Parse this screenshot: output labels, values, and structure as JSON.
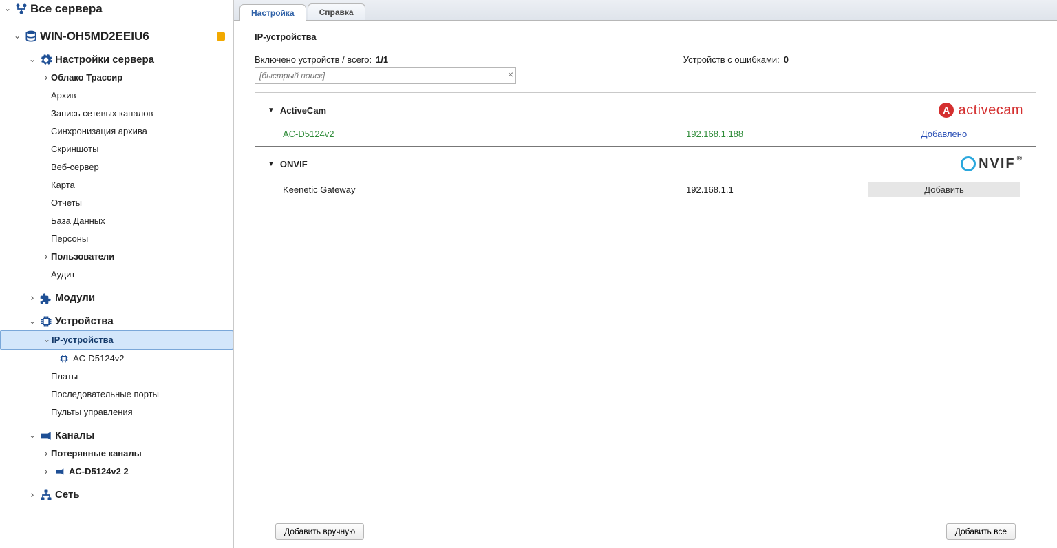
{
  "sidebar": {
    "root": {
      "label": "Все сервера"
    },
    "server": {
      "label": "WIN-OH5MD2EEIU6"
    },
    "settings": {
      "label": "Настройки сервера"
    },
    "cloud": {
      "label": "Облако Трассир"
    },
    "archive": {
      "label": "Архив"
    },
    "netrec": {
      "label": "Запись сетевых каналов"
    },
    "archsync": {
      "label": "Синхронизация архива"
    },
    "screenshots": {
      "label": "Скриншоты"
    },
    "webserver": {
      "label": "Веб-сервер"
    },
    "map": {
      "label": "Карта"
    },
    "reports": {
      "label": "Отчеты"
    },
    "database": {
      "label": "База Данных"
    },
    "persons": {
      "label": "Персоны"
    },
    "users": {
      "label": "Пользователи"
    },
    "audit": {
      "label": "Аудит"
    },
    "modules": {
      "label": "Модули"
    },
    "devices": {
      "label": "Устройства"
    },
    "ipdev": {
      "label": "IP-устройства"
    },
    "ipdev_child": {
      "label": "AC-D5124v2"
    },
    "boards": {
      "label": "Платы"
    },
    "serialports": {
      "label": "Последовательные порты"
    },
    "controlpanels": {
      "label": "Пульты управления"
    },
    "channels": {
      "label": "Каналы"
    },
    "lostch": {
      "label": "Потерянные каналы"
    },
    "camch": {
      "label": "AC-D5124v2 2"
    },
    "network": {
      "label": "Сеть"
    }
  },
  "tabs": {
    "settings": "Настройка",
    "help": "Справка"
  },
  "page": {
    "title": "IP-устройства",
    "enabled_label": "Включено устройств / всего:",
    "enabled_value": "1/1",
    "errors_label": "Устройств с ошибками:",
    "errors_value": "0",
    "search_placeholder": "[быстрый поиск]"
  },
  "groups": [
    {
      "name": "ActiveCam",
      "logo": "activecam",
      "devices": [
        {
          "name": "AC-D5124v2",
          "ip": "192.168.1.188",
          "action_type": "added",
          "action_label": "Добавлено"
        }
      ]
    },
    {
      "name": "ONVIF",
      "logo": "onvif",
      "devices": [
        {
          "name": "Keenetic Gateway",
          "ip": "192.168.1.1",
          "action_type": "button",
          "action_label": "Добавить"
        }
      ]
    }
  ],
  "logos": {
    "activecam_text": "activecam",
    "onvif_text": "NVIF"
  },
  "footer": {
    "add_manual": "Добавить вручную",
    "add_all": "Добавить все"
  }
}
